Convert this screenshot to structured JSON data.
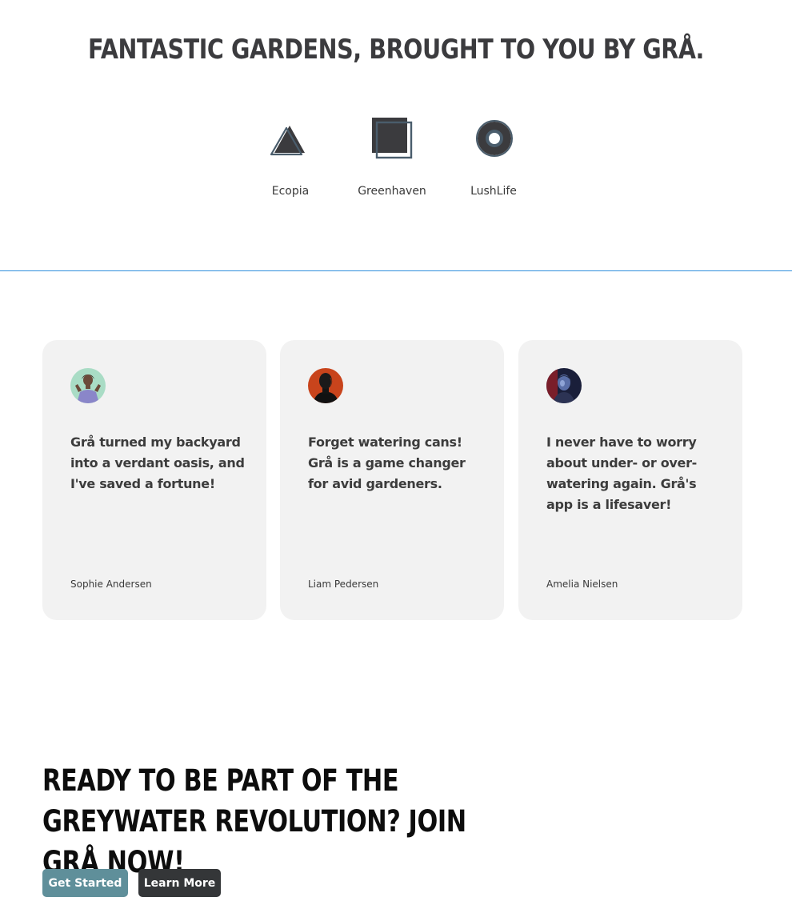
{
  "partners": {
    "title": "Fantastic Gardens, brought to you by Grå.",
    "logos": [
      {
        "name": "Ecopia",
        "icon": "triangle-icon"
      },
      {
        "name": "Greenhaven",
        "icon": "square-icon"
      },
      {
        "name": "LushLife",
        "icon": "ring-icon"
      }
    ]
  },
  "testimonials": [
    {
      "quote": "Grå turned my backyard into a verdant oasis, and I've saved a fortune!",
      "author": "Sophie Andersen",
      "avatar": "avatar-photo"
    },
    {
      "quote": "Forget watering cans! Grå is a game changer for avid gardeners.",
      "author": "Liam Pedersen",
      "avatar": "avatar-photo"
    },
    {
      "quote": "I never have to worry about under- or over-watering again. Grå's app is a lifesaver!",
      "author": "Amelia Nielsen",
      "avatar": "avatar-photo"
    }
  ],
  "cta": {
    "title": "Ready to be part of the greywater revolution? Join Grå now!",
    "primary_label": "Get Started",
    "secondary_label": "Learn More"
  },
  "colors": {
    "divider": "#2f8fdc",
    "card_bg": "#f2f2f2",
    "primary_button": "#5f8f9a",
    "secondary_button": "#343638",
    "logo_dark": "#3b3b3e",
    "logo_accent": "#4a5d6c"
  }
}
